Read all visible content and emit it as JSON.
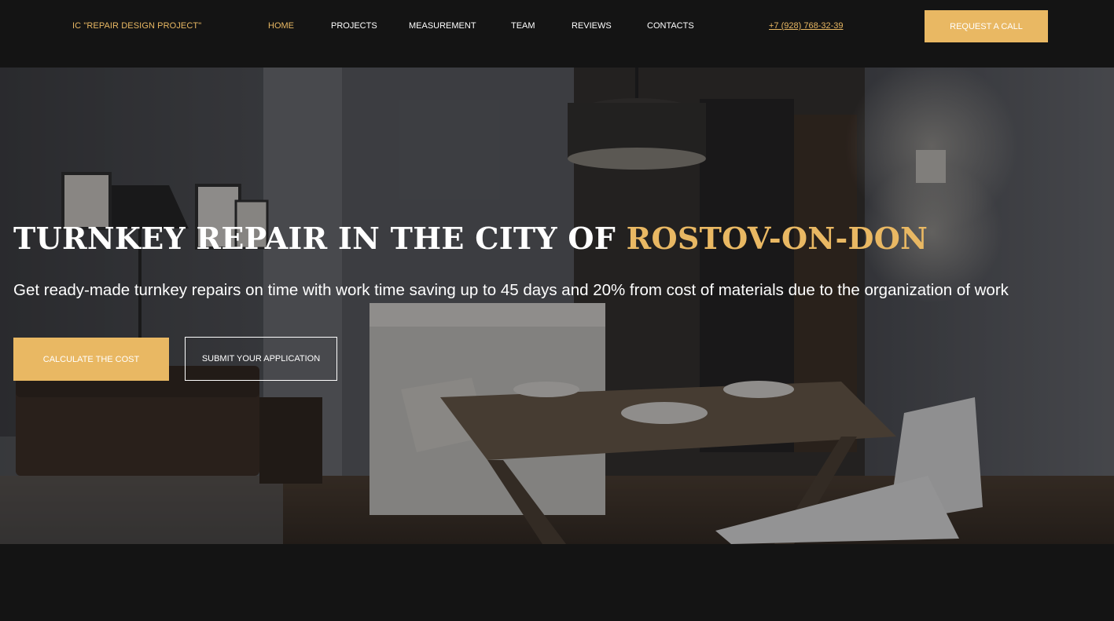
{
  "header": {
    "logo": "IC \"REPAIR DESIGN PROJECT\"",
    "nav": [
      {
        "label": "HOME",
        "active": true
      },
      {
        "label": "PROJECTS",
        "active": false
      },
      {
        "label": "MEASUREMENT",
        "active": false
      },
      {
        "label": "TEAM",
        "active": false
      },
      {
        "label": "REVIEWS",
        "active": false
      },
      {
        "label": "CONTACTS",
        "active": false
      }
    ],
    "phone": "+7 (928) 768-32-39",
    "call_button": "REQUEST A CALL"
  },
  "hero": {
    "title_main": "TURNKEY REPAIR IN THE CITY OF ",
    "title_accent": "ROSTOV-ON-DON",
    "subtitle": "Get ready-made turnkey repairs on time with work time saving up to 45 days and 20% from cost of materials due to the organization of work",
    "primary_button": "CALCULATE THE COST",
    "secondary_button": "SUBMIT YOUR APPLICATION"
  },
  "colors": {
    "accent": "#e9b863",
    "background": "#141414",
    "text": "#ffffff"
  }
}
